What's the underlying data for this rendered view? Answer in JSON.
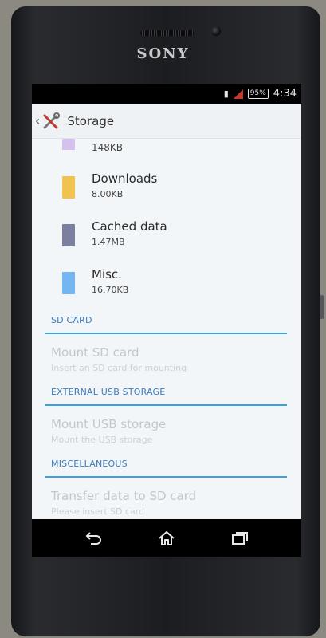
{
  "device": {
    "brand": "SONY"
  },
  "status_bar": {
    "battery": "95%",
    "time": "4:34"
  },
  "action_bar": {
    "title": "Storage",
    "back_icon": "chevron-left-icon",
    "app_icon": "settings-tools-icon"
  },
  "storage_items": [
    {
      "label": "",
      "size": "148KB",
      "color": "#d6c1ee"
    },
    {
      "label": "Downloads",
      "size": "8.00KB",
      "color": "#f2c24f"
    },
    {
      "label": "Cached data",
      "size": "1.47MB",
      "color": "#7c809f"
    },
    {
      "label": "Misc.",
      "size": "16.70KB",
      "color": "#73b6f2"
    }
  ],
  "sections": {
    "sd_card": {
      "header": "SD CARD",
      "title": "Mount SD card",
      "subtitle": "Insert an SD card for mounting"
    },
    "usb": {
      "header": "EXTERNAL USB STORAGE",
      "title": "Mount USB storage",
      "subtitle": "Mount the USB storage"
    },
    "misc": {
      "header": "MISCELLANEOUS",
      "title": "Transfer data to SD card",
      "subtitle": "Please insert SD card"
    }
  },
  "nav_bar": {
    "back": "back-icon",
    "home": "home-icon",
    "recents": "recent-apps-icon"
  },
  "colors": {
    "accent": "#35a3df",
    "header_text": "#3a7bbf"
  }
}
